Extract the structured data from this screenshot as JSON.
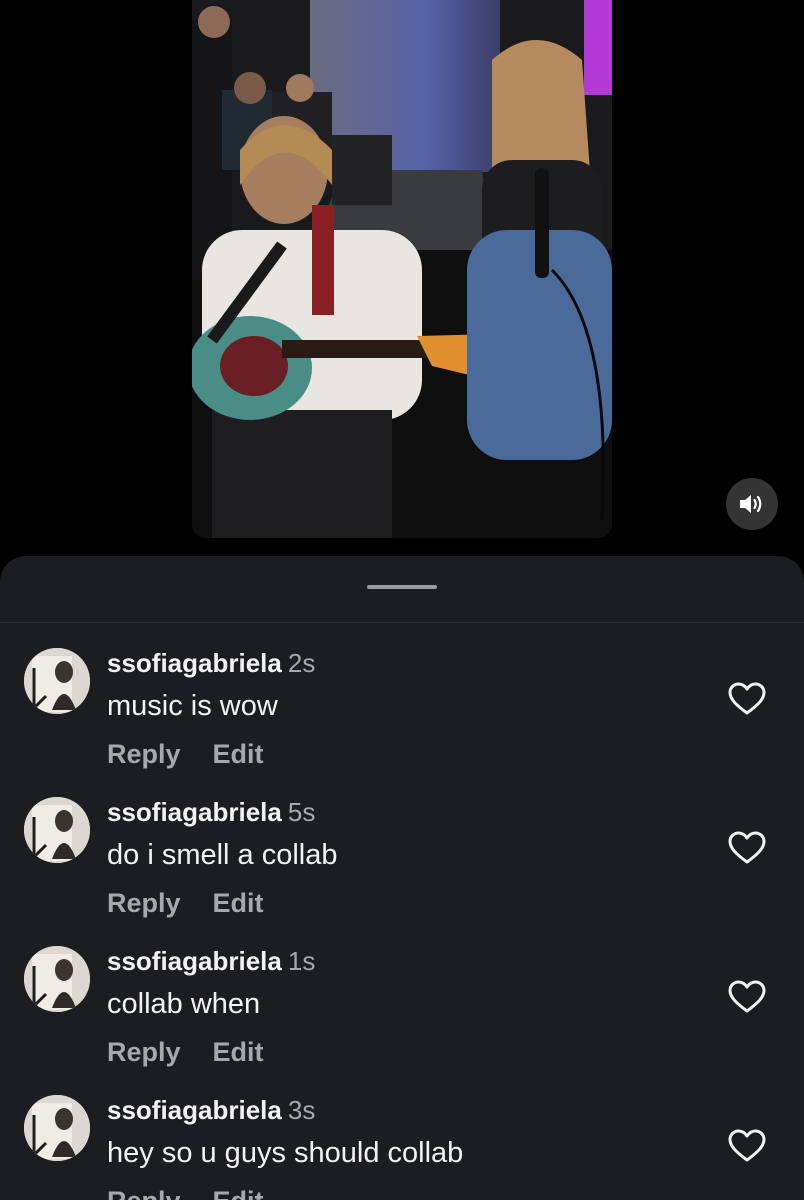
{
  "video": {
    "sound_icon": "speaker-on-icon"
  },
  "sheet": {
    "grabber_icon": "drag-handle"
  },
  "comments": [
    {
      "username": "ssofiagabriela",
      "time": "2s",
      "text": "music is wow",
      "reply_label": "Reply",
      "edit_label": "Edit"
    },
    {
      "username": "ssofiagabriela",
      "time": "5s",
      "text": "do i smell a collab",
      "reply_label": "Reply",
      "edit_label": "Edit"
    },
    {
      "username": "ssofiagabriela",
      "time": "1s",
      "text": "collab when",
      "reply_label": "Reply",
      "edit_label": "Edit"
    },
    {
      "username": "ssofiagabriela",
      "time": "3s",
      "text": "hey so u guys should collab",
      "reply_label": "Reply",
      "edit_label": "Edit"
    }
  ],
  "colors": {
    "sheet_background": "#1b1d20",
    "primary_text": "#f2f2f2",
    "secondary_text": "#a6a8ab"
  }
}
